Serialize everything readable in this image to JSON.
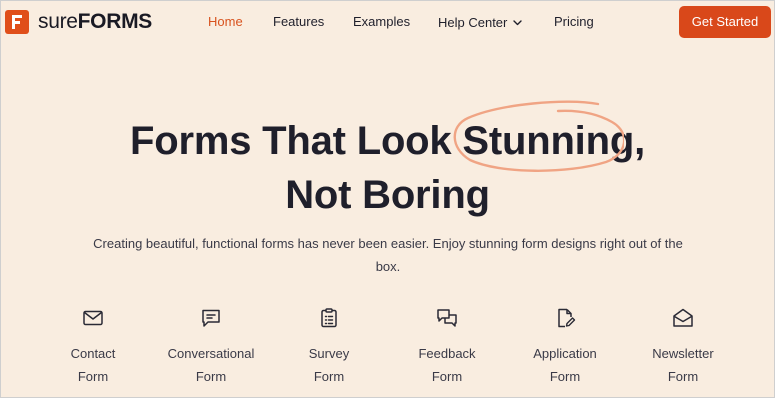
{
  "brand": {
    "name_light": "sure",
    "name_bold": "FORMS",
    "accent_color": "#d9481a"
  },
  "nav": {
    "items": [
      {
        "label": "Home",
        "active": true
      },
      {
        "label": "Features"
      },
      {
        "label": "Examples"
      },
      {
        "label": "Help Center",
        "has_dropdown": true
      },
      {
        "label": "Pricing"
      }
    ],
    "cta_label": "Get Started"
  },
  "hero": {
    "title_before": "Forms That Look ",
    "title_highlight": "Stunning",
    "title_after": ",",
    "title_line2": "Not Boring",
    "subtitle": "Creating beautiful, functional forms has never been easier. Enjoy stunning form designs right out of the box."
  },
  "form_types": [
    {
      "label": "Contact\nForm",
      "icon": "envelope-icon"
    },
    {
      "label": "Conversational\nForm",
      "icon": "chat-bubble-icon"
    },
    {
      "label": "Survey\nForm",
      "icon": "clipboard-icon"
    },
    {
      "label": "Feedback\nForm",
      "icon": "feedback-chat-icon"
    },
    {
      "label": "Application\nForm",
      "icon": "document-edit-icon"
    },
    {
      "label": "Newsletter\nForm",
      "icon": "open-envelope-icon"
    }
  ]
}
